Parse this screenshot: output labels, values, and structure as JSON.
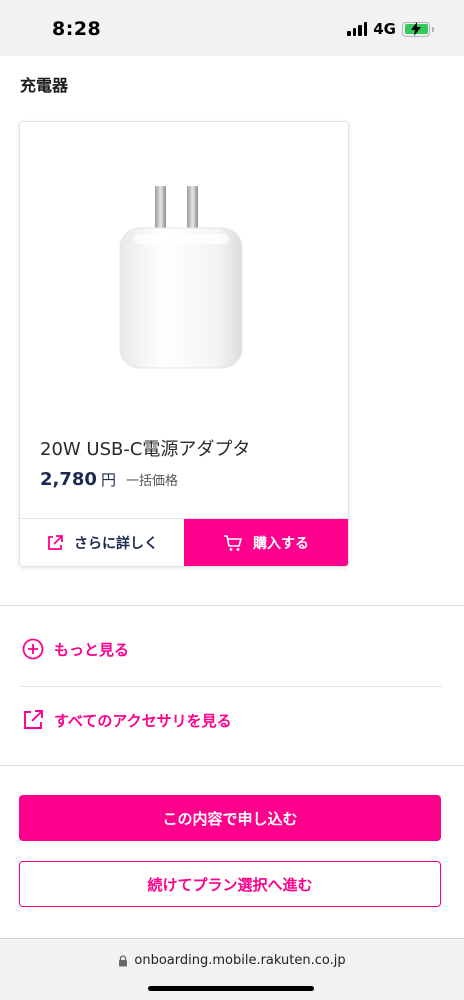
{
  "status_bar": {
    "time": "8:28",
    "network": "4G",
    "battery_color": "#34c759"
  },
  "section": {
    "title": "充電器"
  },
  "product": {
    "name": "20W USB-C電源アダプタ",
    "price": "2,780",
    "price_unit": "円",
    "price_note": "一括価格",
    "image_icon": "usb-c-power-adapter-image",
    "detail_button": "さらに詳しく",
    "detail_icon": "external-link-icon",
    "buy_button": "購入する",
    "buy_icon": "cart-icon"
  },
  "links": {
    "more": "もっと見る",
    "more_icon": "plus-circle-icon",
    "all_accessories": "すべてのアクセサリを見る",
    "all_accessories_icon": "external-link-icon"
  },
  "actions": {
    "apply": "この内容で申し込む",
    "continue_plan": "続けてプラン選択へ進む"
  },
  "browser": {
    "url": "onboarding.mobile.rakuten.co.jp",
    "lock_icon": "lock-icon"
  },
  "colors": {
    "accent": "#ff008c",
    "navy": "#1b2a4e"
  }
}
